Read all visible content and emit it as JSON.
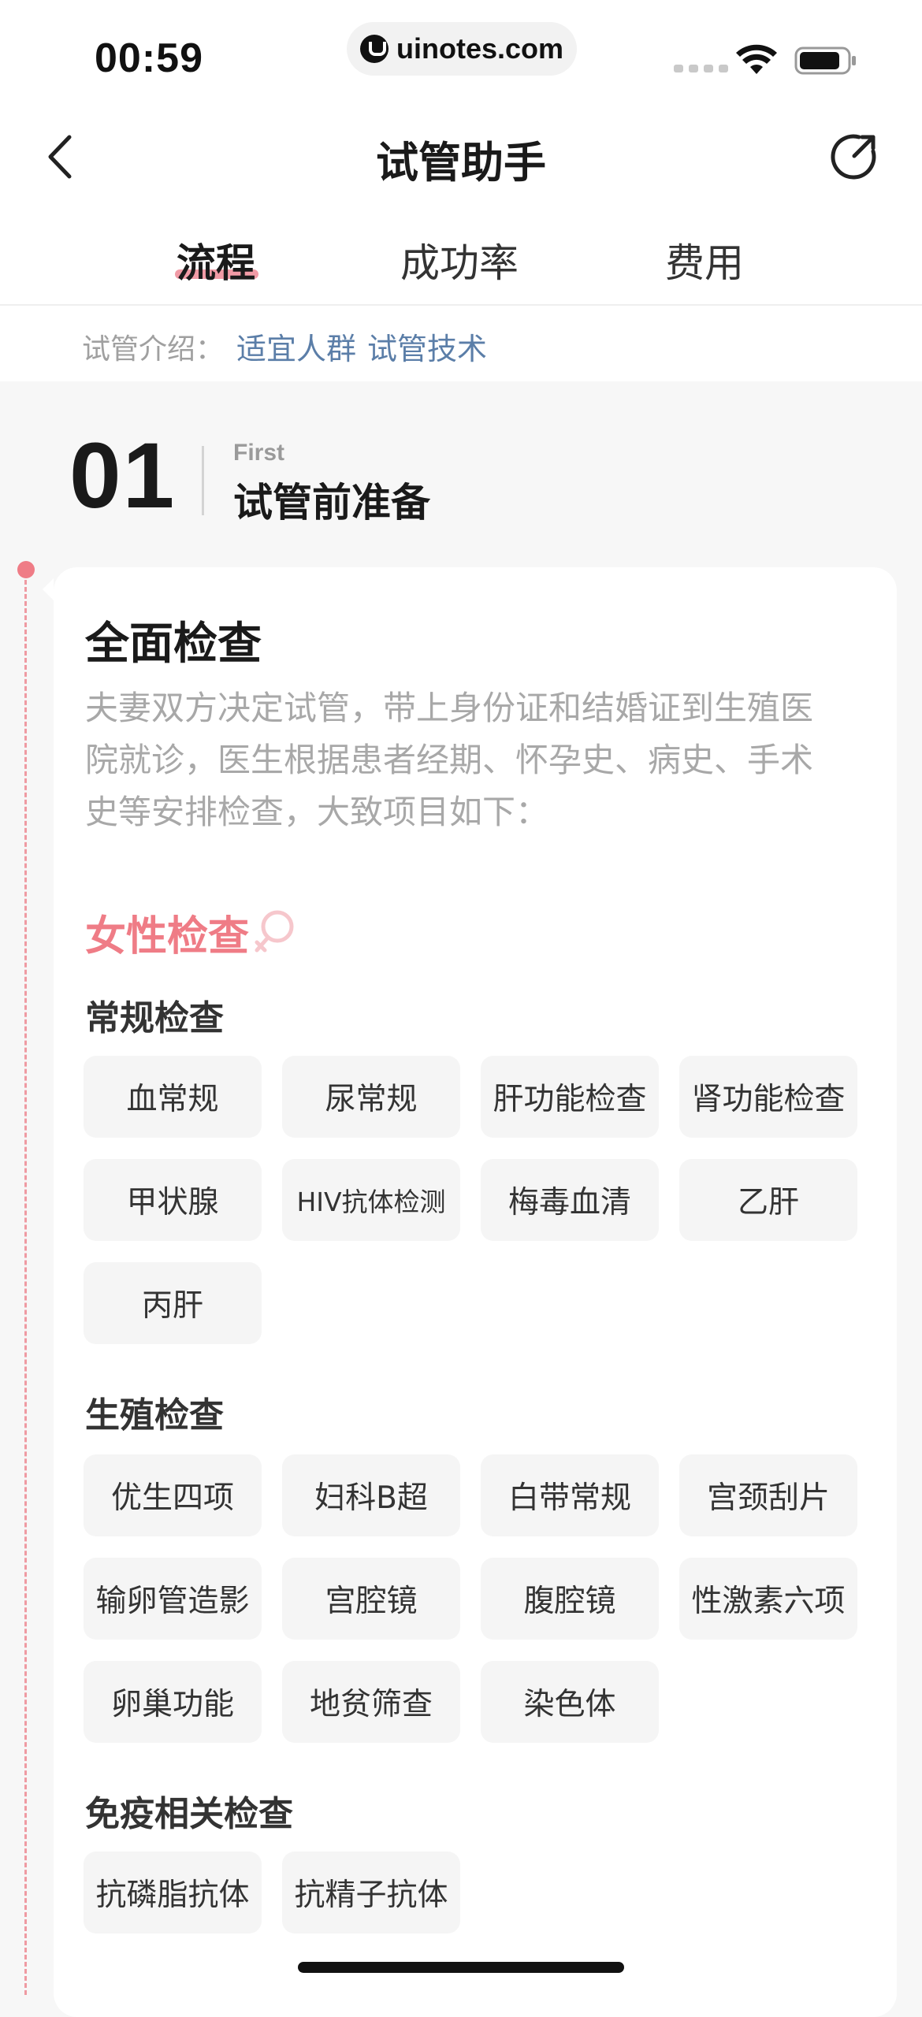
{
  "status_bar": {
    "time": "00:59",
    "url": "uinotes.com"
  },
  "nav": {
    "title": "试管助手"
  },
  "tabs": [
    {
      "label": "流程",
      "active": true
    },
    {
      "label": "成功率",
      "active": false
    },
    {
      "label": "费用",
      "active": false
    }
  ],
  "intro": {
    "label": "试管介绍：",
    "links": [
      "适宜人群",
      "试管技术"
    ]
  },
  "step": {
    "number": "01",
    "en": "First",
    "title": "试管前准备"
  },
  "card": {
    "title": "全面检查",
    "desc_lines": [
      "夫妻双方决定试管，带上身份证和结婚证到生殖医",
      "院就诊，医生根据患者经期、怀孕史、病史、手术",
      "史等安排检查，大致项目如下："
    ],
    "female_title": "女性检查",
    "sections": [
      {
        "title": "常规检查",
        "items": [
          "血常规",
          "尿常规",
          "肝功能检查",
          "肾功能检查",
          "甲状腺",
          "HIV抗体检测",
          "梅毒血清",
          "乙肝",
          "丙肝"
        ]
      },
      {
        "title": "生殖检查",
        "items": [
          "优生四项",
          "妇科B超",
          "白带常规",
          "宫颈刮片",
          "输卵管造影",
          "宫腔镜",
          "腹腔镜",
          "性激素六项",
          "卵巢功能",
          "地贫筛查",
          "染色体"
        ]
      },
      {
        "title": "免疫相关检查",
        "items": [
          "抗磷脂抗体",
          "抗精子抗体"
        ]
      }
    ]
  },
  "colors": {
    "accent_pink": "#ef7c86",
    "link_blue": "#5b7ea8",
    "muted_text": "#a8a8a8",
    "tag_bg": "#f5f5f5"
  },
  "icons": [
    "back-chevron-icon",
    "share-icon",
    "female-symbol-icon",
    "wifi-icon",
    "battery-icon"
  ]
}
